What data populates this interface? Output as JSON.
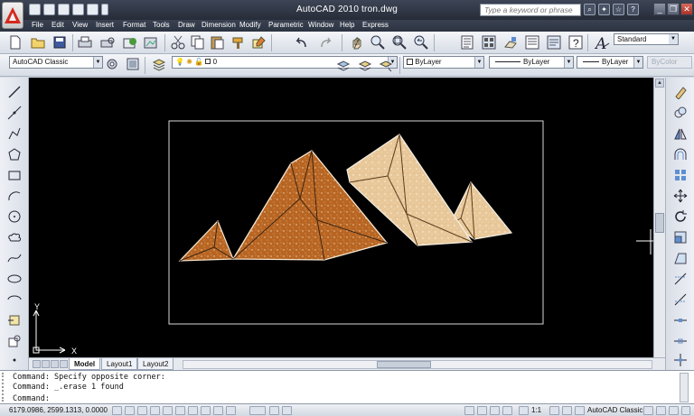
{
  "window": {
    "title": "AutoCAD 2010    tron.dwg",
    "search_placeholder": "Type a keyword or phrase",
    "controls": [
      "_",
      "❐",
      "✕"
    ]
  },
  "menu": [
    "File",
    "Edit",
    "View",
    "Insert",
    "Format",
    "Tools",
    "Draw",
    "Dimension",
    "Modify",
    "Parametric",
    "Window",
    "Help",
    "Express"
  ],
  "toolbar": {
    "text_style": "Standard"
  },
  "properties": {
    "workspace": "AutoCAD Classic",
    "layer": "0",
    "color": "ByLayer",
    "linetype": "ByLayer",
    "lineweight": "ByLayer",
    "plotstyle": "ByColor"
  },
  "canvas": {
    "ucs_x": "X",
    "ucs_y": "Y"
  },
  "layout_tabs": [
    "Model",
    "Layout1",
    "Layout2"
  ],
  "command": {
    "history": [
      "Command: Specify opposite corner:",
      "Command: _.erase 1 found"
    ],
    "prompt": "Command:"
  },
  "status": {
    "coords": "6179.0986, 2599.1313, 0.0000",
    "scale": "1:1",
    "workspace": "AutoCAD Classic"
  },
  "colors": {
    "pyramid_dark": "#b86523",
    "pyramid_light": "#e8c89a",
    "canvas_bg": "#000000",
    "title_bg": "#2f3645"
  }
}
